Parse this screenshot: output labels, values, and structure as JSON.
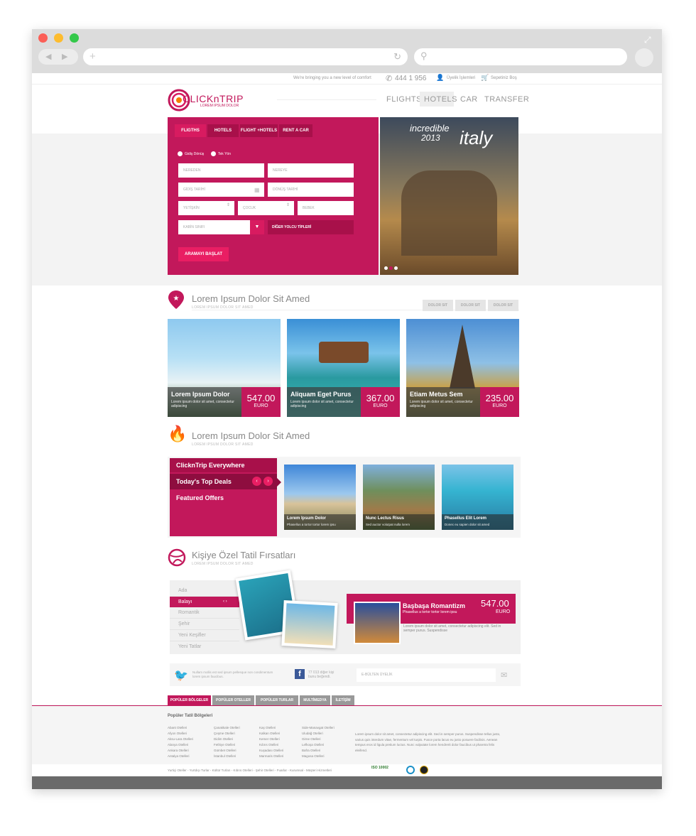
{
  "topbar": {
    "tagline": "We're bringing you a new level of comfort",
    "phone": "444 1 956",
    "member": "Üyelik İşlemleri",
    "cart": "Sepetiniz Boş"
  },
  "logo": {
    "name": "CLICKnTRIP",
    "tagline": "LOREM IPSUM DOLOR"
  },
  "nav": [
    "FLIGHTS",
    "HOTELS",
    "CAR",
    "TRANSFER"
  ],
  "search": {
    "tabs": [
      "FLIGTHS",
      "HOTELS",
      "FLIGHT +HOTELS",
      "RENT A CAR"
    ],
    "radio1": "Gidiş Dönüş",
    "radio2": "Tek Yön",
    "from": "NEREDEN",
    "to": "NEREYE",
    "depart": "GİDİŞ TARİHİ",
    "return": "DÖNÜŞ TARİHİ",
    "adult": "YETİŞKİN",
    "child": "ÇOCUK",
    "baby": "BEBEK",
    "cabin": "KABİN SINIFI",
    "other": "DİĞER YOLCU TİPLERİ",
    "submit": "ARAMAYI BAŞLAT"
  },
  "hero": {
    "text1": "incredible",
    "text2": "2013",
    "text3": "italy"
  },
  "section1": {
    "title": "Lorem Ipsum Dolor Sit Amed",
    "sub": "LOREM IPSUM DOLOR SIT AMED",
    "pills": [
      "DOLOR SIT",
      "DOLOR SIT",
      "DOLOR SIT"
    ],
    "cards": [
      {
        "title": "Lorem Ipsum Dolor",
        "desc": "Lorem ipsum dolor sit amet, consectetur adipiscing",
        "price": "547.00",
        "cur": "EURO"
      },
      {
        "title": "Aliquam Eget Purus",
        "desc": "Lorem ipsum dolor sit amet, consectetur adipiscing",
        "price": "367.00",
        "cur": "EURO"
      },
      {
        "title": "Etiam Metus Sem",
        "desc": "Lorem ipsum dolor sit amet, consectetur adipiscing",
        "price": "235.00",
        "cur": "EURO"
      }
    ]
  },
  "section2": {
    "title": "Lorem Ipsum Dolor Sit Amed",
    "sub": "LOREM IPSUM DOLOR SIT AMED",
    "menu": [
      "ClicknTrip Everywhere",
      "Today's Top Deals",
      "Featured Offers"
    ],
    "items": [
      {
        "title": "Lorem Ipsum Dolor",
        "desc": "Phasellus a tortor tortor lorem ipsu"
      },
      {
        "title": "Nunc Lectus Risus",
        "desc": "Sed auctor volutpat nulla lorem"
      },
      {
        "title": "Phasellus Elit Lorem",
        "desc": "Donec eu sapien dolor sit amed"
      }
    ]
  },
  "section3": {
    "title": "Kişiye Özel Tatil Fırsatları",
    "sub": "LOREM IPSUM DOLOR SIT AMED",
    "list": [
      "Ada",
      "Balayı",
      "Romantik",
      "Şehir",
      "Yeni Keşifler",
      "Yeni Tatlar"
    ],
    "offer": {
      "title": "Başbaşa Romantizm",
      "desc": "Phasellus a tortor tortor lorem ipsu",
      "price": "547.00",
      "cur": "EURO",
      "text": "Lorem ipsum dolor sit amet, consectetur adipiscing elit. Sed in semper purus. Suspendisse"
    }
  },
  "social": {
    "twitter": "Nullam mollis est sed ipsum pellesque non condimentum lorem ipsum faucibus.",
    "facebook": "77 013 diğer kişi bunu beğendi.",
    "newsletter": "E-BÜLTEN ÜYELİK"
  },
  "footer": {
    "tabs": [
      "POPÜLER BÖLGELER",
      "POPÜLER OTELLER",
      "POPÜLER TURLAR",
      "MULTİMEDYA",
      "İLETİŞİM"
    ],
    "heading": "Popüler Tatil Bölgeleri",
    "col1": [
      "Abant Otelleri",
      "Afyon Otelleri",
      "Aksu-Lara Otelleri",
      "Alanya Otelleri",
      "Ankara Otelleri",
      "Antalya Otelleri"
    ],
    "col2": [
      "Çanakkale Otelleri",
      "Çeşme Otelleri",
      "Didim Otelleri",
      "Fethiye Otelleri",
      "Gümbet Otelleri",
      "İstanbul Otelleri"
    ],
    "col3": [
      "Kaş Otelleri",
      "Kalkan Otelleri",
      "Kemer Otelleri",
      "Kıbrıs Otelleri",
      "Kuşadası Otelleri",
      "Marmaris Otelleri"
    ],
    "col4": [
      "Side-Manavgat Otelleri",
      "Uludağ Otelleri",
      "Girne Otelleri",
      "Lefkoşa Otelleri",
      "Bafra Otelleri",
      "Magosa Otelleri"
    ],
    "text": "Lorem ipsum dolor sit amet, consectetur adipiscing elit. Sed in semper purus. Suspendisse tellus justo, varius quis interdum vitae, fermentum vel turpis. Fusce porta lacus eu justo posuere facilisis. Aenean tempus eros id ligula pretium luctus. Nunc vulputate lorem hendrerit dolor faucibus ut pharetra felis eleifend.",
    "links": "Yurtiçi Oteller - Yurtdışı Turlar - Kültür Turları - Kıbrıs Otelleri - Şehir Otelleri - Fuarlar - Kurumsal - Müşteri Hizmetleri",
    "iso": "ISO 10002"
  }
}
